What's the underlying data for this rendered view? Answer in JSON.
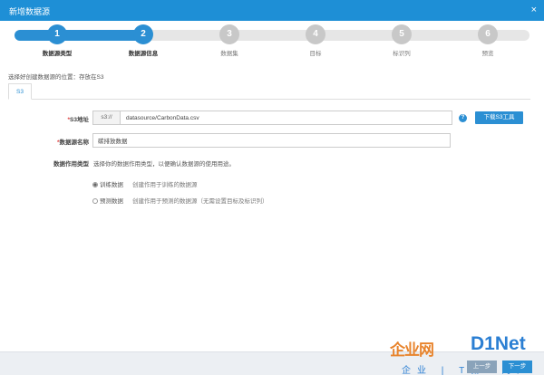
{
  "window": {
    "title": "新增数据源",
    "close_icon": "×"
  },
  "colors": {
    "accent": "#2b8fd3",
    "titlebar": "#1e8fd6",
    "inactive_step": "#c8c8c8",
    "required": "#e04040"
  },
  "steps": [
    {
      "number": "1",
      "label": "数据源类型",
      "state": "done"
    },
    {
      "number": "2",
      "label": "数据源信息",
      "state": "current"
    },
    {
      "number": "3",
      "label": "数据集",
      "state": "todo"
    },
    {
      "number": "4",
      "label": "目标",
      "state": "todo"
    },
    {
      "number": "5",
      "label": "标识列",
      "state": "todo"
    },
    {
      "number": "6",
      "label": "预览",
      "state": "todo"
    }
  ],
  "location_hint": "选择好创建数据源的位置：存放在S3",
  "tabs": [
    {
      "label": "S3",
      "active": true
    }
  ],
  "form": {
    "s3_address": {
      "required_mark": "*",
      "label": "S3地址",
      "prefix": "s3://",
      "value": "datasource/CarbonData.csv"
    },
    "help_icon": "?",
    "download_button": "下载S3工具",
    "source_name": {
      "required_mark": "*",
      "label": "数据源名称",
      "value": "碳排放数据"
    },
    "source_type": {
      "label": "数据作用类型",
      "description": "选择你的数据作用类型，以便确认数据源的使用用途。",
      "options": [
        {
          "label": "训练数据",
          "description": "创建作用于训练的数据源",
          "selected": true
        },
        {
          "label": "预测数据",
          "description": "创建作用于预测的数据源（无需设置目标及标识列）",
          "selected": false
        }
      ]
    }
  },
  "footer": {
    "prev_button": "上一步",
    "next_button": "下一步"
  },
  "watermark": {
    "left_text": "企业网",
    "right_text": "D1Net",
    "bottom_text": "企业 | T第一门户"
  }
}
